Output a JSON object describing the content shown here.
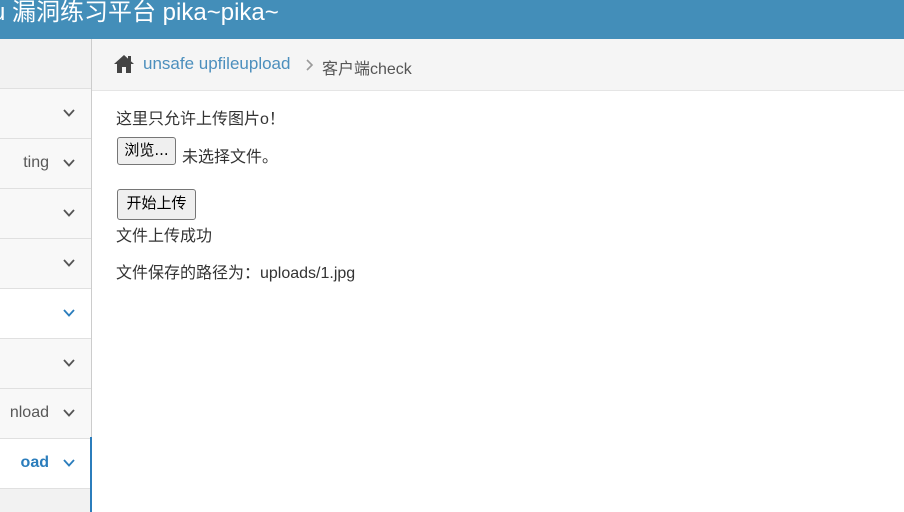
{
  "navbar": {
    "brand": "u 漏洞练习平台 pika~pika~"
  },
  "sidebar": {
    "items": [
      {
        "label": "",
        "icon": "chevron-down-icon"
      },
      {
        "label": "ting",
        "icon": "chevron-down-icon"
      },
      {
        "label": "",
        "icon": "chevron-down-icon"
      },
      {
        "label": "",
        "icon": "chevron-down-icon"
      },
      {
        "label": "",
        "icon": "chevron-down-icon"
      },
      {
        "label": "",
        "icon": "chevron-down-icon"
      },
      {
        "label": "nload",
        "icon": "chevron-down-icon"
      },
      {
        "label": "oad",
        "icon": "chevron-down-icon"
      }
    ]
  },
  "breadcrumb": {
    "home_icon": "home-icon",
    "link": "unsafe upfileupload",
    "separator_icon": "chevron-right-icon",
    "current": "客户端check"
  },
  "main": {
    "intro": "这里只允许上传图片o！",
    "browse_label": "浏览...",
    "file_status": "未选择文件。",
    "upload_label": "开始上传",
    "result": "文件上传成功",
    "path": "文件保存的路径为：uploads/1.jpg"
  },
  "colors": {
    "navbar": "#438eb9",
    "link": "#4c8fbd",
    "active": "#2b7dbc",
    "sidebar_bg": "#f2f2f2"
  }
}
